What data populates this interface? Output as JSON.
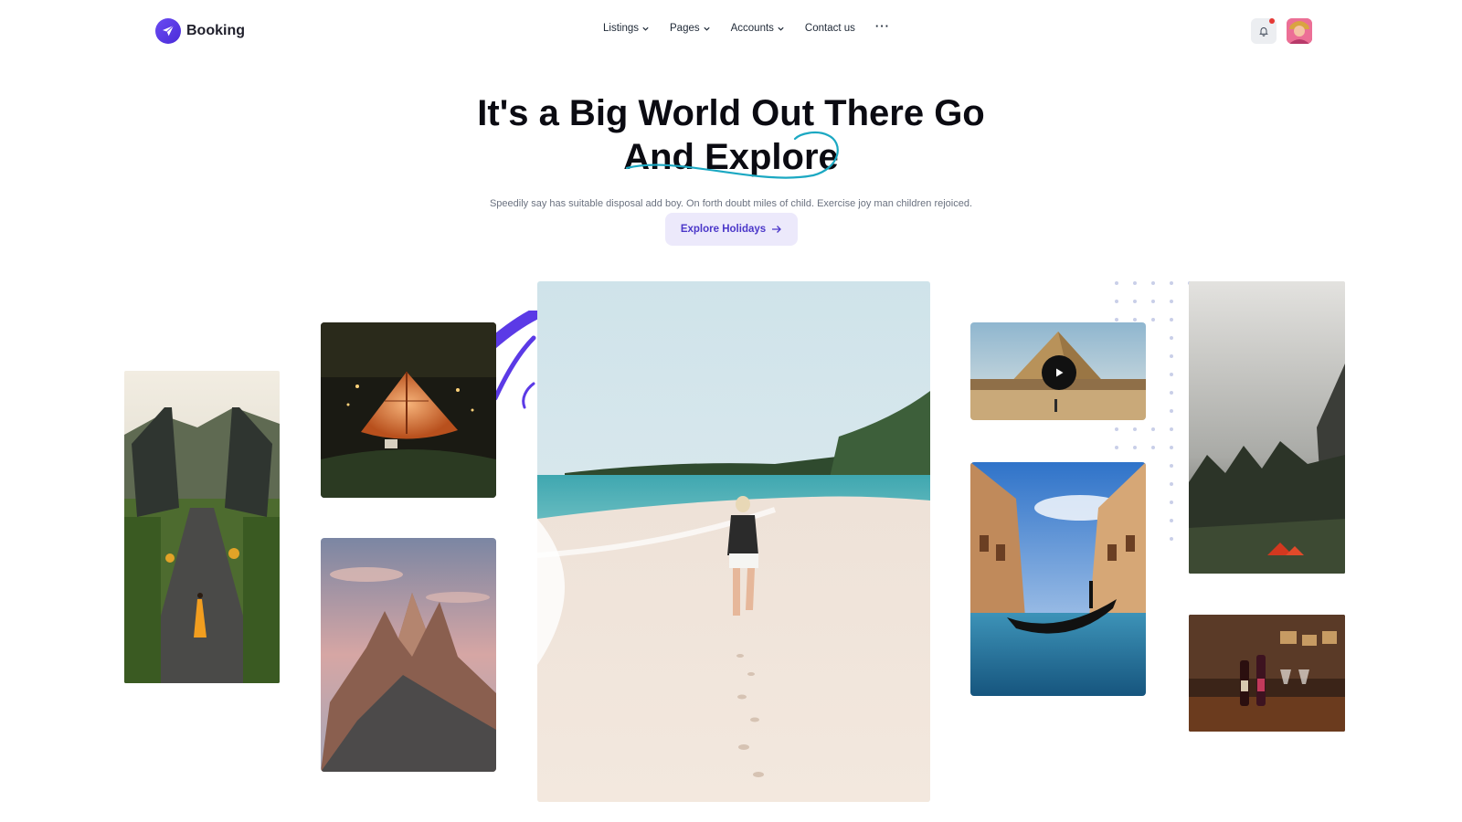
{
  "brand": {
    "name": "Booking",
    "icon": "plane-icon",
    "color": "#5b3ae6"
  },
  "nav": {
    "items": [
      {
        "label": "Listings",
        "has_dropdown": true
      },
      {
        "label": "Pages",
        "has_dropdown": true
      },
      {
        "label": "Accounts",
        "has_dropdown": true
      },
      {
        "label": "Contact us",
        "has_dropdown": false
      }
    ],
    "more_label": "···"
  },
  "header_actions": {
    "notification_icon": "bell-icon",
    "has_unread": true,
    "avatar_icon": "user-avatar"
  },
  "hero": {
    "title_line1": "It's a Big World Out There Go",
    "title_line2": "And Explore",
    "subtitle": "Speedily say has suitable disposal add boy. On forth doubt miles of child. Exercise joy man children rejoiced.",
    "cta_label": "Explore Holidays",
    "cta_icon": "arrow-right-icon",
    "accent_color": "#4b37c9"
  },
  "gallery": {
    "photos": [
      {
        "name": "temple-gate-photo"
      },
      {
        "name": "camping-tent-photo"
      },
      {
        "name": "mountain-peak-photo"
      },
      {
        "name": "beach-walk-photo"
      },
      {
        "name": "pyramids-video"
      },
      {
        "name": "venice-gondola-photo"
      },
      {
        "name": "misty-forest-photo"
      },
      {
        "name": "wine-bar-photo"
      }
    ],
    "play_icon": "play-icon"
  }
}
